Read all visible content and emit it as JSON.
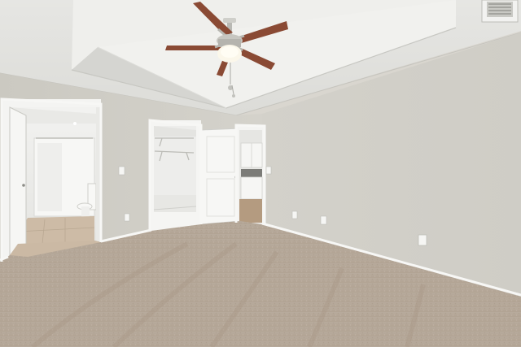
{
  "scene": {
    "kind": "empty bedroom interior",
    "colors": {
      "wall": "#d6d4cd",
      "ceiling": "#ecebe8",
      "carpet": "#b9ab9c",
      "trim": "#f4f4f2",
      "fan_blade": "#8a4a34",
      "tile": "#cdbba6"
    },
    "objects": [
      {
        "name": "ceiling-fan"
      },
      {
        "name": "tray-ceiling"
      },
      {
        "name": "hvac-vent"
      },
      {
        "name": "bathroom-doorway"
      },
      {
        "name": "closet-doorway"
      },
      {
        "name": "hallway-doorway"
      },
      {
        "name": "wall-outlet"
      },
      {
        "name": "light-switch"
      },
      {
        "name": "carpet-floor"
      }
    ]
  }
}
